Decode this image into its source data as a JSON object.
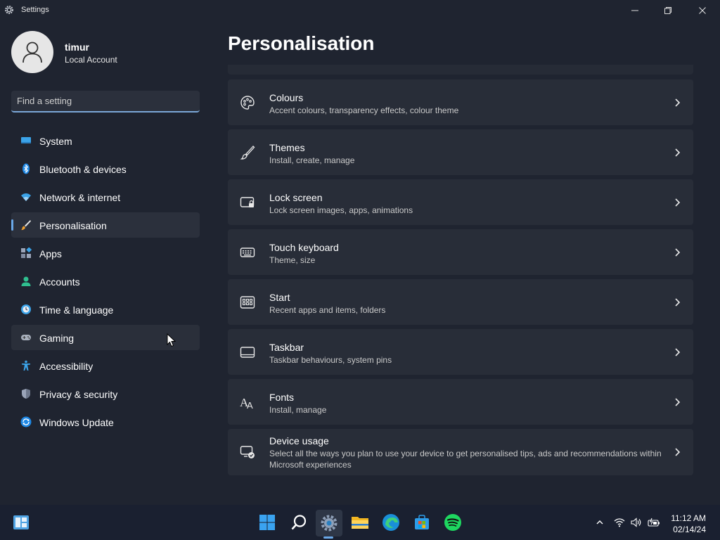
{
  "window": {
    "title": "Settings"
  },
  "profile": {
    "username": "timur",
    "account_type": "Local Account"
  },
  "search": {
    "placeholder": "Find a setting"
  },
  "nav": {
    "items": [
      {
        "label": "System",
        "icon": "system-icon"
      },
      {
        "label": "Bluetooth & devices",
        "icon": "bluetooth-icon"
      },
      {
        "label": "Network & internet",
        "icon": "wifi-icon"
      },
      {
        "label": "Personalisation",
        "icon": "brush-icon",
        "active": true
      },
      {
        "label": "Apps",
        "icon": "apps-icon"
      },
      {
        "label": "Accounts",
        "icon": "accounts-icon"
      },
      {
        "label": "Time & language",
        "icon": "clock-globe-icon"
      },
      {
        "label": "Gaming",
        "icon": "gamepad-icon",
        "hovered": true
      },
      {
        "label": "Accessibility",
        "icon": "accessibility-icon"
      },
      {
        "label": "Privacy & security",
        "icon": "shield-icon"
      },
      {
        "label": "Windows Update",
        "icon": "update-icon"
      }
    ]
  },
  "main": {
    "title": "Personalisation",
    "cards": [
      {
        "title": "Colours",
        "desc": "Accent colours, transparency effects, colour theme",
        "icon": "palette-icon"
      },
      {
        "title": "Themes",
        "desc": "Install, create, manage",
        "icon": "brush-icon"
      },
      {
        "title": "Lock screen",
        "desc": "Lock screen images, apps, animations",
        "icon": "lock-screen-icon"
      },
      {
        "title": "Touch keyboard",
        "desc": "Theme, size",
        "icon": "keyboard-icon"
      },
      {
        "title": "Start",
        "desc": "Recent apps and items, folders",
        "icon": "start-icon"
      },
      {
        "title": "Taskbar",
        "desc": "Taskbar behaviours, system pins",
        "icon": "taskbar-icon"
      },
      {
        "title": "Fonts",
        "desc": "Install, manage",
        "icon": "fonts-icon"
      },
      {
        "title": "Device usage",
        "desc": "Select all the ways you plan to use your device to get personalised tips, ads and recommendations within Microsoft experiences",
        "icon": "device-usage-icon"
      }
    ]
  },
  "taskbar": {
    "apps": [
      "windows-start-icon",
      "search-icon",
      "settings-icon",
      "file-explorer-icon",
      "edge-icon",
      "store-icon",
      "spotify-icon"
    ],
    "tray": [
      "chevron-up-icon",
      "wifi-icon",
      "volume-icon",
      "battery-icon"
    ],
    "time": "11:12 AM",
    "date": "02/14/24"
  },
  "colors": {
    "accent": "#6aa8e8",
    "background": "#1f2430",
    "card": "#282d38"
  }
}
